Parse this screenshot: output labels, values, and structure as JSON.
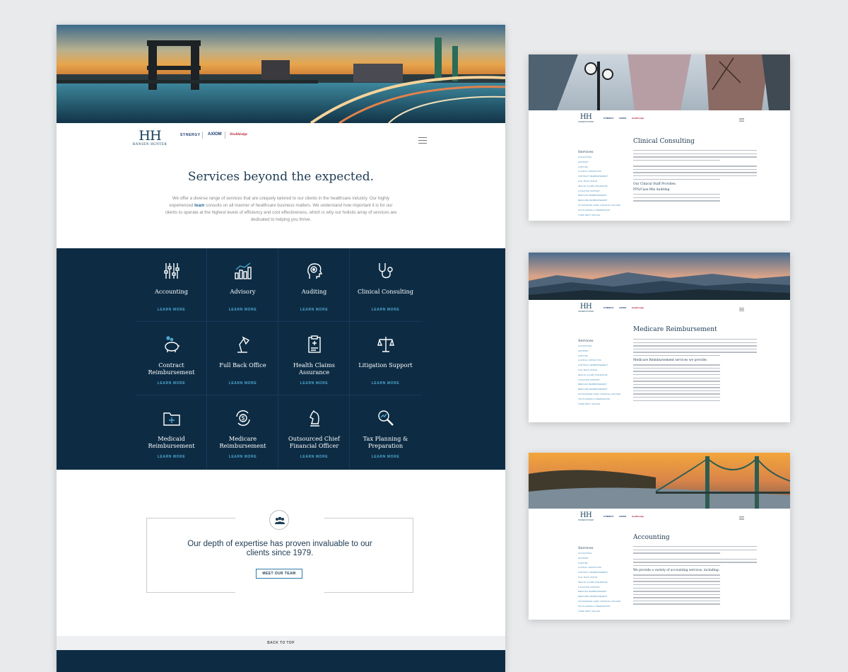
{
  "main": {
    "logo": {
      "mark": "HH",
      "name": "HANSEN·HUNTER"
    },
    "partners": [
      "SYNERGY",
      "AXIOM",
      "Healthlodge"
    ],
    "heading": "Services beyond the expected.",
    "intro_before": "We offer a diverse range of services that are uniquely tailored to our clients in the healthcare industry. Our highly experienced ",
    "intro_link": "team",
    "intro_after": " consults on all manner of healthcare business matters. We understand how important it is for our clients to operate at the highest levels of efficiency and cost effectiveness, which is why our holistic array of services are dedicated to helping you thrive.",
    "services": [
      {
        "title": "Accounting",
        "cta": "LEARN MORE",
        "icon": "sliders-icon"
      },
      {
        "title": "Advisory",
        "cta": "LEARN MORE",
        "icon": "bar-chart-icon"
      },
      {
        "title": "Auditing",
        "cta": "LEARN MORE",
        "icon": "head-gear-icon"
      },
      {
        "title": "Clinical Consulting",
        "cta": "LEARN MORE",
        "icon": "stethoscope-icon"
      },
      {
        "title": "Contract Reimbursement",
        "cta": "LEARN MORE",
        "icon": "piggy-bank-icon"
      },
      {
        "title": "Full Back Office",
        "cta": "LEARN MORE",
        "icon": "desk-lamp-icon"
      },
      {
        "title": "Health Claims Assurance",
        "cta": "LEARN MORE",
        "icon": "clipboard-icon"
      },
      {
        "title": "Litigation Support",
        "cta": "LEARN MORE",
        "icon": "scales-icon"
      },
      {
        "title": "Medicaid Reimbursement",
        "cta": "LEARN MORE",
        "icon": "folder-plus-icon"
      },
      {
        "title": "Medicare Reimbursement",
        "cta": "LEARN MORE",
        "icon": "dollar-cycle-icon"
      },
      {
        "title": "Outsourced Chief Financial Officer",
        "cta": "LEARN MORE",
        "icon": "chess-knight-icon"
      },
      {
        "title": "Tax Planning & Preparation",
        "cta": "LEARN MORE",
        "icon": "magnifier-icon"
      }
    ],
    "expertise": "Our depth of expertise has proven invaluable to our clients since 1979.",
    "team_button": "MEET OUR TEAM",
    "back_to_top": "BACK TO TOP"
  },
  "side_pages": [
    {
      "title": "Clinical Consulting",
      "nav_heading": "Services",
      "nav_items": [
        "ACCOUNTING",
        "ADVISORY",
        "AUDITING",
        "CLINICAL CONSULTING",
        "CONTRACT REIMBURSEMENT",
        "FULL BACK OFFICE",
        "HEALTH CLAIMS ASSURANCE",
        "LITIGATION SUPPORT",
        "MEDICAID REIMBURSEMENT",
        "MEDICARE REIMBURSEMENT",
        "OUTSOURCED CHIEF FINANCIAL OFFICER",
        "TAX PLANNING & PREPARATION",
        "THIRD PARTY BILLING"
      ],
      "subheading": "Our Clinical Staff Provides:",
      "subheading2": "PPS/Case-Mix Auditing"
    },
    {
      "title": "Medicare Reimbursement",
      "nav_heading": "Services",
      "nav_items": [
        "ACCOUNTING",
        "ADVISORY",
        "AUDITING",
        "CLINICAL CONSULTING",
        "CONTRACT REIMBURSEMENT",
        "FULL BACK OFFICE",
        "HEALTH CLAIMS ASSURANCE",
        "LITIGATION SUPPORT",
        "MEDICAID REIMBURSEMENT",
        "MEDICARE REIMBURSEMENT",
        "OUTSOURCED CHIEF FINANCIAL OFFICER",
        "TAX PLANNING & PREPARATION",
        "THIRD PARTY BILLING"
      ],
      "subheading": "Medicare Reimbursement services we provide:"
    },
    {
      "title": "Accounting",
      "nav_heading": "Services",
      "nav_items": [
        "ACCOUNTING",
        "ADVISORY",
        "AUDITING",
        "CLINICAL CONSULTING",
        "CONTRACT REIMBURSEMENT",
        "FULL BACK OFFICE",
        "HEALTH CLAIMS ASSURANCE",
        "LITIGATION SUPPORT",
        "MEDICAID REIMBURSEMENT",
        "MEDICARE REIMBURSEMENT",
        "OUTSOURCED CHIEF FINANCIAL OFFICER",
        "TAX PLANNING & PREPARATION",
        "THIRD PARTY BILLING"
      ],
      "subheading": "We provide a variety of accounting services, including:"
    }
  ],
  "colors": {
    "navy": "#0d2c44",
    "accent": "#4fa7d0",
    "heading": "#1e3b52"
  }
}
